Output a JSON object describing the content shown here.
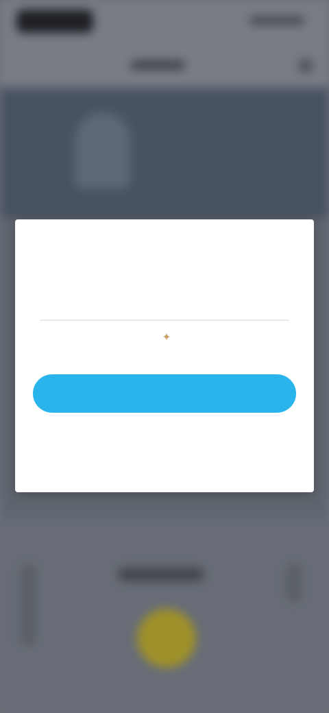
{
  "modal": {
    "title": "",
    "subtext": "",
    "primary_button_label": "",
    "secondary_link_label": ""
  },
  "icons": {
    "modal_sparkle": "sparkle-icon"
  },
  "colors": {
    "primary_button": "#2ab4ec",
    "fab": "#b9a727",
    "modal_background": "#ffffff"
  }
}
